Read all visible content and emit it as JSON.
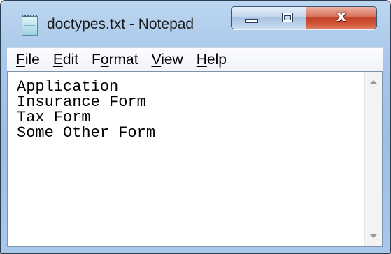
{
  "window": {
    "title": "doctypes.txt - Notepad",
    "app_icon": "notepad-icon",
    "controls": {
      "minimize_icon": "minimize-icon",
      "maximize_icon": "maximize-icon",
      "close_glyph": "x",
      "close_icon": "close-icon"
    }
  },
  "menubar": {
    "items": [
      {
        "accel": "F",
        "rest": "ile"
      },
      {
        "accel": "E",
        "rest": "dit"
      },
      {
        "pre": "F",
        "accel": "o",
        "rest": "rmat"
      },
      {
        "accel": "V",
        "rest": "iew"
      },
      {
        "accel": "H",
        "rest": "elp"
      }
    ]
  },
  "editor": {
    "content": "Application\nInsurance Form\nTax Form\nSome Other Form"
  },
  "colors": {
    "close_button": "#c2412a",
    "frame": "#a9c8ea"
  }
}
